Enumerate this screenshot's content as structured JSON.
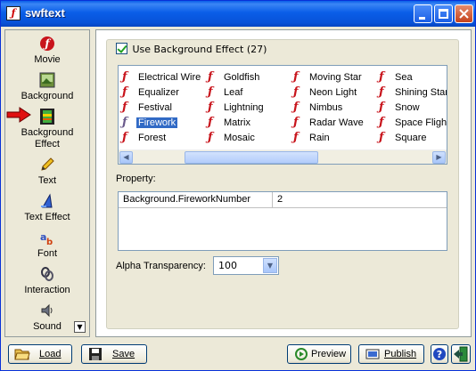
{
  "window": {
    "title": "swftext"
  },
  "sidebar": {
    "items": [
      {
        "label": "Movie",
        "icon": "movie-icon"
      },
      {
        "label": "Background",
        "icon": "background-icon"
      },
      {
        "label": "Background Effect",
        "icon": "background-effect-icon"
      },
      {
        "label": "Text",
        "icon": "pencil-icon"
      },
      {
        "label": "Text Effect",
        "icon": "text-effect-icon"
      },
      {
        "label": "Font",
        "icon": "font-icon"
      },
      {
        "label": "Interaction",
        "icon": "interaction-icon"
      },
      {
        "label": "Sound",
        "icon": "speaker-icon"
      }
    ],
    "selected": "Background Effect"
  },
  "effects": {
    "checkbox_label": "Use Background Effect (27)",
    "checked": true,
    "columns": [
      [
        "Electrical Wire",
        "Equalizer",
        "Festival",
        "Firework",
        "Forest"
      ],
      [
        "Goldfish",
        "Leaf",
        "Lightning",
        "Matrix",
        "Mosaic"
      ],
      [
        "Moving Star",
        "Neon Light",
        "Nimbus",
        "Radar Wave",
        "Rain"
      ],
      [
        "Sea",
        "Shining Star",
        "Snow",
        "Space Flight",
        "Square"
      ]
    ],
    "selected": "Firework"
  },
  "property": {
    "label": "Property:",
    "rows": [
      {
        "name": "Background.FireworkNumber",
        "value": "2"
      }
    ]
  },
  "alpha": {
    "label": "Alpha Transparency:",
    "value": "100"
  },
  "buttons": {
    "load": "Load",
    "save": "Save",
    "preview": "Preview",
    "publish": "Publish"
  },
  "colors": {
    "titlebar": "#0a5ee8",
    "selection": "#316ac5",
    "effect_icon": "#c8141c"
  }
}
